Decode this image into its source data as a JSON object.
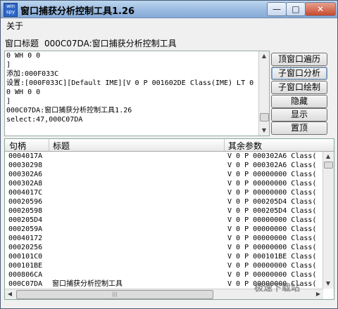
{
  "window": {
    "title": "窗口捕获分析控制工具1.26",
    "app_icon_text": "win spy",
    "controls": {
      "minimize": "—",
      "maximize": "□",
      "close": "✕"
    }
  },
  "menu": {
    "items": [
      "关于"
    ]
  },
  "header": {
    "label": "窗口标题",
    "value": "000C07DA:窗口捕获分析控制工具"
  },
  "log": {
    "lines": [
      "0 WH 0 0",
      "]",
      "添加:000F033C",
      "设置:[000F033C][Default IME][V 0 P 001602DE Class(IME) LT 0",
      "0 WH 0 0",
      "]",
      "000C07DA:窗口捕获分析控制工具1.26",
      "select:47,000C07DA"
    ]
  },
  "buttons": [
    {
      "label": "顶窗口遍历"
    },
    {
      "label": "子窗口分析"
    },
    {
      "label": "子窗口绘制"
    },
    {
      "label": "隐藏"
    },
    {
      "label": "显示"
    },
    {
      "label": "置顶"
    }
  ],
  "table": {
    "columns": [
      "句柄",
      "标题",
      "其余参数"
    ],
    "rows": [
      {
        "handle": "0004017A",
        "title": "",
        "params": "V 0 P 000302A6 Class("
      },
      {
        "handle": "00030298",
        "title": "",
        "params": "V 0 P 000302A6 Class("
      },
      {
        "handle": "000302A6",
        "title": "",
        "params": "V 0 P 00000000 Class("
      },
      {
        "handle": "000302A8",
        "title": "",
        "params": "V 0 P 00000000 Class("
      },
      {
        "handle": "0004017C",
        "title": "",
        "params": "V 0 P 00000000 Class("
      },
      {
        "handle": "00020596",
        "title": "",
        "params": "V 0 P 000205D4 Class("
      },
      {
        "handle": "00020598",
        "title": "",
        "params": "V 0 P 000205D4 Class("
      },
      {
        "handle": "000205D4",
        "title": "",
        "params": "V 0 P 00000000 Class("
      },
      {
        "handle": "0002059A",
        "title": "",
        "params": "V 0 P 00000000 Class("
      },
      {
        "handle": "00040172",
        "title": "",
        "params": "V 0 P 00000000 Class("
      },
      {
        "handle": "00020256",
        "title": "",
        "params": "V 0 P 00000000 Class("
      },
      {
        "handle": "000101C0",
        "title": "",
        "params": "V 0 P 000101BE Class("
      },
      {
        "handle": "000101BE",
        "title": "",
        "params": "V 0 P 00000000 Class("
      },
      {
        "handle": "000806CA",
        "title": "",
        "params": "V 0 P 00000000 Class("
      },
      {
        "handle": "000C07DA",
        "title": "窗口捕获分析控制工具",
        "params": "V 0 P 00000000 Class("
      }
    ]
  },
  "scroll_glyphs": {
    "up": "▲",
    "down": "▼",
    "left": "◀",
    "right": "▶",
    "grip": "|||"
  },
  "watermark": "极速下载站"
}
